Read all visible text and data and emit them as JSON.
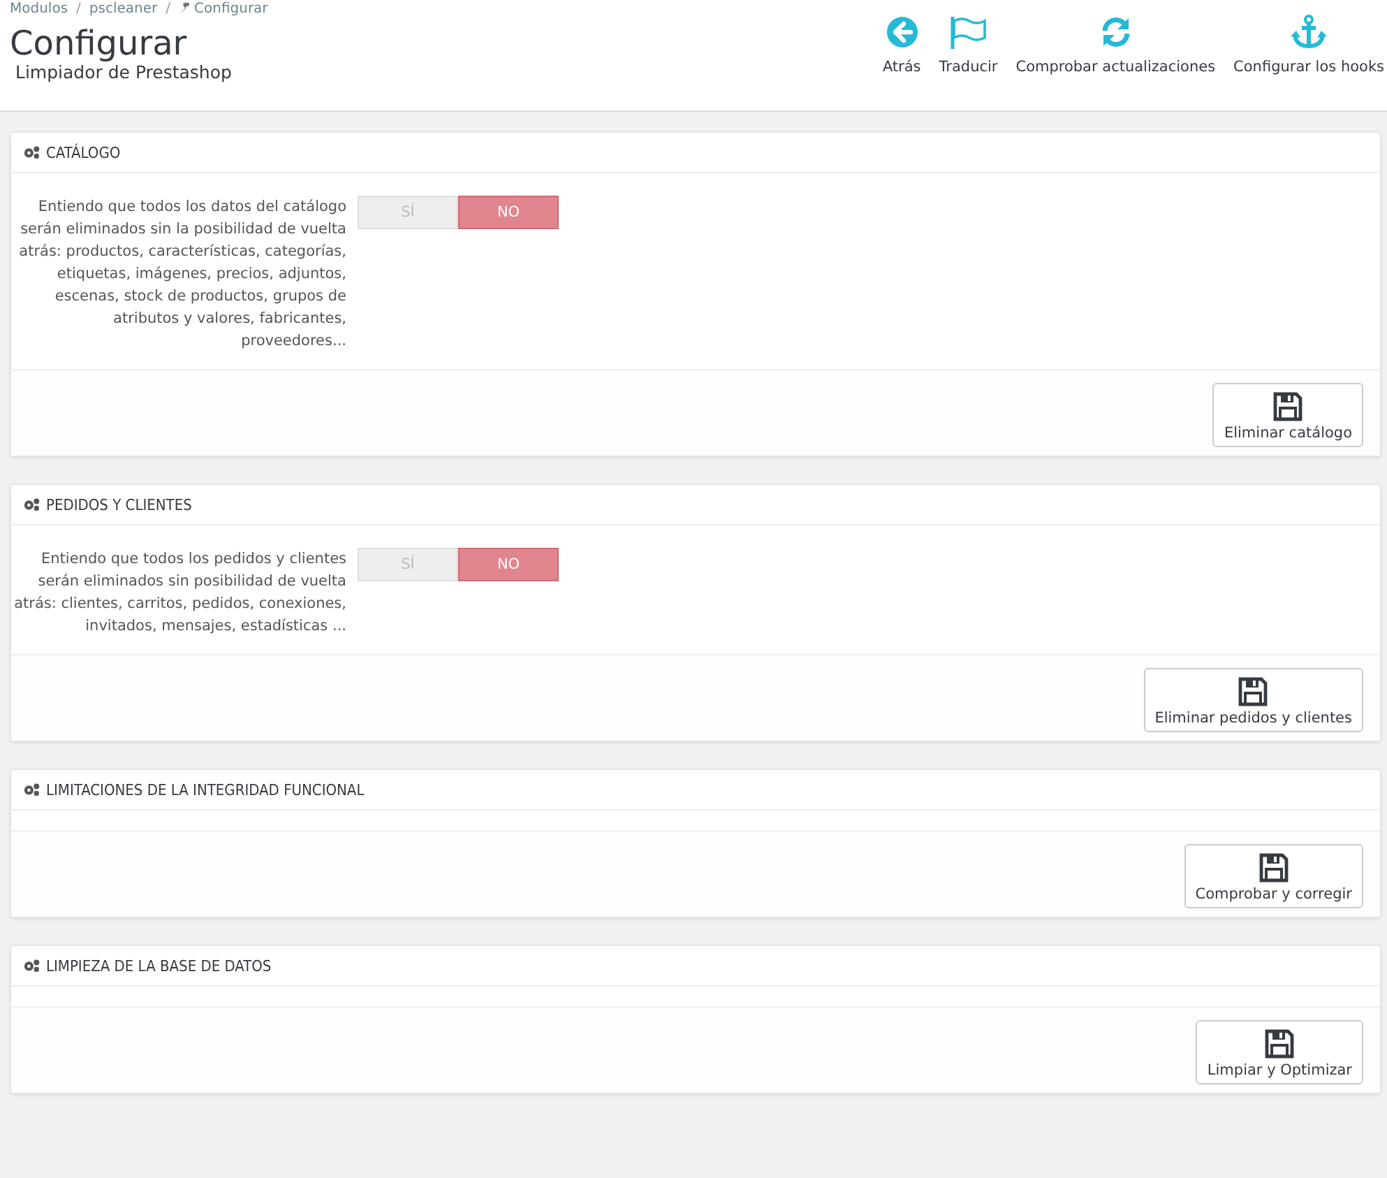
{
  "breadcrumb": [
    "Modulos",
    "pscleaner",
    "Configurar"
  ],
  "breadcrumb_separator": "/",
  "page_title": "Configurar",
  "page_subtitle": "Limpiador de Prestashop",
  "toolbar": [
    "Atrás",
    "Traducir",
    "Comprobar actualizaciones",
    "Configurar los hooks"
  ],
  "panels": [
    {
      "title": "CATÁLOGO",
      "description": "Entiendo que todos los datos del catálogo serán eliminados sin la posibilidad de vuelta atrás: productos, características, categorías, etiquetas, imágenes, precios, adjuntos, escenas, stock de productos, grupos de atributos y valores, fabricantes, proveedores...",
      "switch": [
        {
          "label": "SÍ",
          "selected": false
        },
        {
          "label": "NO",
          "selected": true
        }
      ],
      "button": "Eliminar catálogo"
    },
    {
      "title": "PEDIDOS Y CLIENTES",
      "description": "Entiendo que todos los pedidos y clientes serán eliminados sin posibilidad de vuelta atrás: clientes, carritos, pedidos, conexiones, invitados, mensajes, estadísticas ...",
      "switch": [
        {
          "label": "SÍ",
          "selected": false
        },
        {
          "label": "NO",
          "selected": true
        }
      ],
      "button": "Eliminar pedidos y clientes"
    },
    {
      "title": "LIMITACIONES DE LA INTEGRIDAD FUNCIONAL",
      "button": "Comprobar y corregir"
    },
    {
      "title": "LIMPIEZA DE LA BASE DE DATOS",
      "button": "Limpiar y Optimizar"
    }
  ]
}
